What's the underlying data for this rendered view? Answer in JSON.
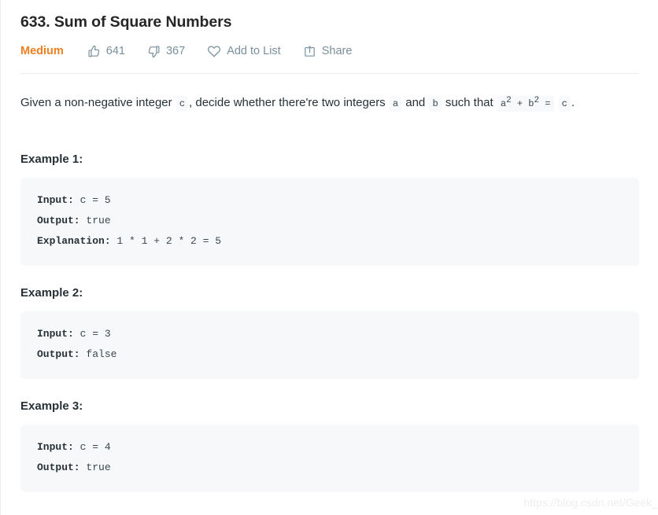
{
  "problem": {
    "title": "633. Sum of Square Numbers",
    "difficulty": "Medium",
    "actions": [
      {
        "icon": "thumbs-up-icon",
        "label": "641"
      },
      {
        "icon": "thumbs-down-icon",
        "label": "367"
      },
      {
        "icon": "heart-icon",
        "label": "Add to List"
      },
      {
        "icon": "share-icon",
        "label": "Share"
      }
    ],
    "description": {
      "part1": "Given a non-negative integer",
      "code_c1": "c",
      "part2": ", decide whether there're two integers",
      "code_a": "a",
      "part3": "and",
      "code_b": "b",
      "part4": "such that",
      "code_formula_a": "a",
      "code_formula_sup1": "2",
      "code_formula_plus": " + ",
      "code_formula_b": "b",
      "code_formula_sup2": "2",
      "code_formula_eq": " =",
      "code_c2": "c",
      "part5": "."
    },
    "examples": [
      {
        "heading": "Example 1:",
        "lines": [
          {
            "key": "Input:",
            "value": " c = 5"
          },
          {
            "key": "Output:",
            "value": " true"
          },
          {
            "key": "Explanation:",
            "value": " 1 * 1 + 2 * 2 = 5"
          }
        ]
      },
      {
        "heading": "Example 2:",
        "lines": [
          {
            "key": "Input:",
            "value": " c = 3"
          },
          {
            "key": "Output:",
            "value": " false"
          }
        ]
      },
      {
        "heading": "Example 3:",
        "lines": [
          {
            "key": "Input:",
            "value": " c = 4"
          },
          {
            "key": "Output:",
            "value": " true"
          }
        ]
      }
    ]
  },
  "watermark": "https://blog.csdn.net/Geek_",
  "colors": {
    "difficulty": "#ef7f21",
    "action_text": "#78909c",
    "code_bg": "#f7f8fa",
    "inline_code_bg": "#f7f9fa",
    "body_text": "#263238",
    "divider": "#eceef0"
  }
}
